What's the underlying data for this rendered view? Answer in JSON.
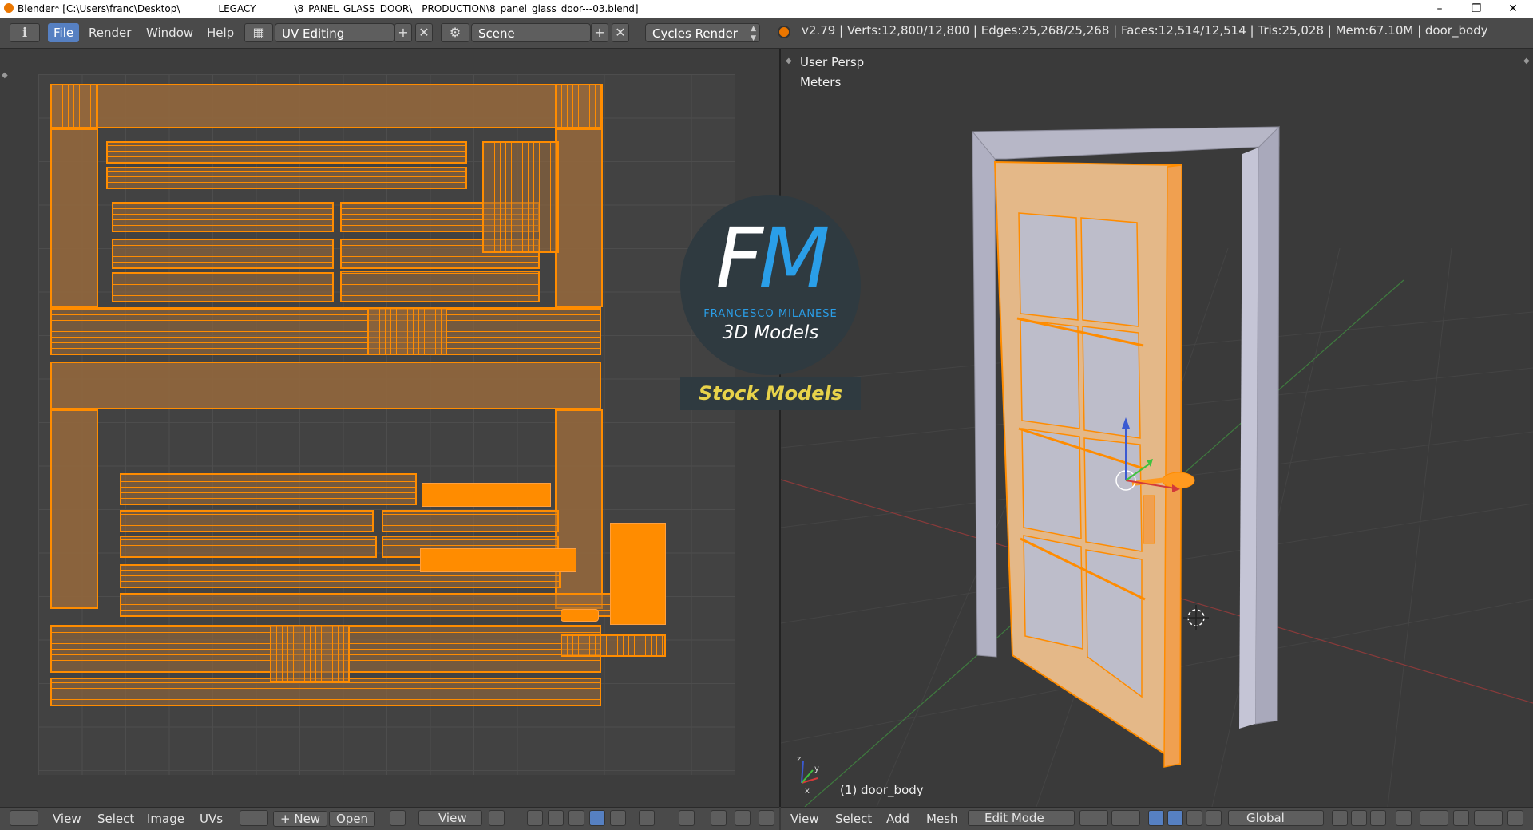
{
  "window": {
    "title": "Blender* [C:\\Users\\franc\\Desktop\\________LEGACY________\\8_PANEL_GLASS_DOOR\\__PRODUCTION\\8_panel_glass_door---03.blend]",
    "minimize": "–",
    "maximize": "❐",
    "close": "✕"
  },
  "menu": {
    "info_icon": "ℹ",
    "file": "File",
    "render": "Render",
    "window": "Window",
    "help": "Help"
  },
  "screen_layout": {
    "value": "UV Editing"
  },
  "scene": {
    "value": "Scene"
  },
  "render_engine": {
    "value": "Cycles Render"
  },
  "stats": "v2.79 | Verts:12,800/12,800 | Edges:25,268/25,268 | Faces:12,514/12,514 | Tris:25,028 | Mem:67.10M | door_body",
  "viewport": {
    "view_name": "User Persp",
    "units": "Meters",
    "object_label": "(1) door_body"
  },
  "watermark": {
    "f": "F",
    "m": "M",
    "name": "FRANCESCO MILANESE",
    "sub": "3D Models",
    "banner": "Stock Models"
  },
  "uv_footer": {
    "view": "View",
    "select": "Select",
    "image": "Image",
    "uvs": "UVs",
    "new": "New",
    "open": "Open",
    "view2": "View"
  },
  "view3d_footer": {
    "view": "View",
    "select": "Select",
    "add": "Add",
    "mesh": "Mesh",
    "mode": "Edit Mode",
    "orientation": "Global"
  },
  "colors": {
    "selection": "#ff8c00",
    "active_tab": "#5680c2",
    "x_axis": "#d23a3a",
    "y_axis": "#3ec23e",
    "z_axis": "#3a5ad2"
  }
}
